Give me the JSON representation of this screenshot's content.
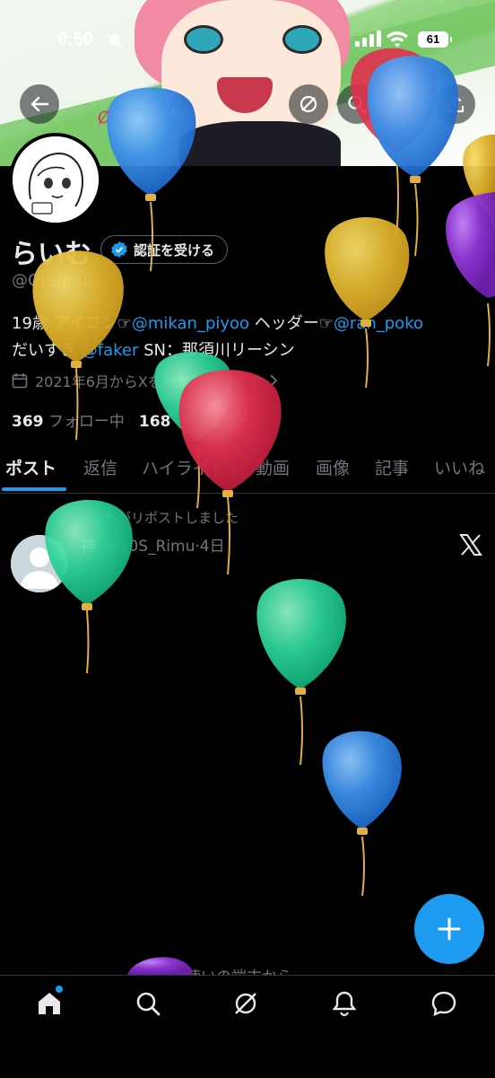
{
  "status_bar": {
    "time": "0:50",
    "battery": "61"
  },
  "profile": {
    "name": "らいむ",
    "verify_label": "認証を受ける",
    "handle": "@QraimuQ",
    "bio": {
      "part1": "19歳 アイコン☞",
      "mention1": "@mikan_piyoo",
      "part2": " ヘッダー☞",
      "mention2": "@ran_poko",
      "part3": "だいすき ",
      "mention3": "@faker",
      "part4": " SN：那須川リーシン"
    },
    "joined": "2021年6月からXを利用しています",
    "following_count": "369",
    "following_label": "フォロー中",
    "followers_count": "168",
    "followers_label": "フォロワー"
  },
  "tabs": [
    "ポスト",
    "返信",
    "ハイライト",
    "動画",
    "画像",
    "記事",
    "いいね"
  ],
  "post": {
    "repost_label": "あなたがリポストしました",
    "author_name": "神",
    "author_handle": "@Q0S_Rimu",
    "time": "4日",
    "partial_text": "お使いの端末から"
  },
  "icons": {
    "back": "arrow-left-icon",
    "search": "search-icon",
    "share": "share-icon",
    "compose": "plus-icon",
    "nav": [
      "home-icon",
      "search-icon",
      "grok-icon",
      "bell-icon",
      "message-icon"
    ]
  },
  "colors": {
    "accent": "#1d9bf0",
    "background": "#000000",
    "muted": "#71767b"
  }
}
